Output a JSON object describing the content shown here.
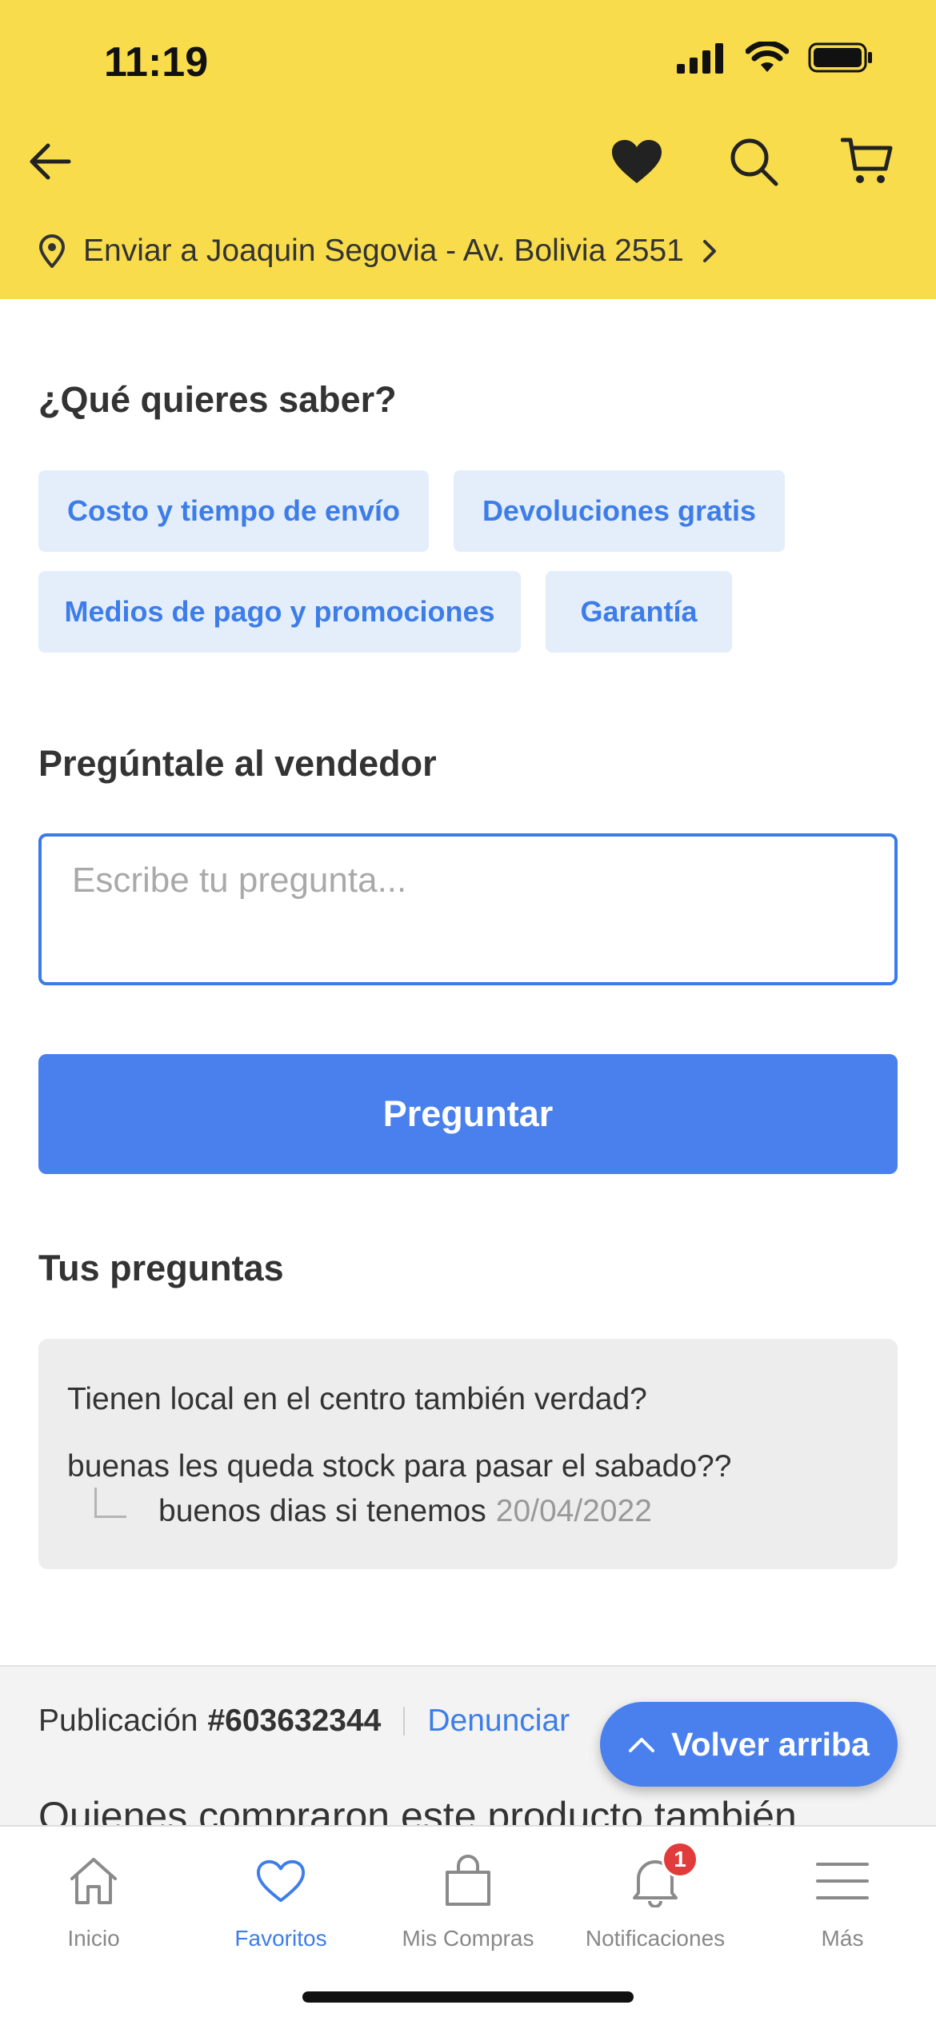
{
  "status_bar": {
    "time": "11:19"
  },
  "header": {
    "ship_to": "Enviar a Joaquin Segovia - Av. Bolivia 2551"
  },
  "faq": {
    "title": "¿Qué quieres saber?",
    "chips": [
      "Costo y tiempo de envío",
      "Devoluciones gratis",
      "Medios de pago y promociones",
      "Garantía"
    ]
  },
  "ask": {
    "title": "Pregúntale al vendedor",
    "placeholder": "Escribe tu pregunta...",
    "button_label": "Preguntar"
  },
  "your_questions": {
    "title": "Tus preguntas",
    "items": [
      {
        "question": "Tienen local en el centro también verdad?"
      },
      {
        "question": "buenas les queda stock para pasar el sabado??",
        "answer": "buenos dias si tenemos",
        "answer_date": "20/04/2022"
      }
    ]
  },
  "publication": {
    "label": "Publicación",
    "number": "#603632344",
    "report_label": "Denunciar"
  },
  "also_bought_title": "Quienes compraron este producto también",
  "back_to_top_label": "Volver arriba",
  "tabbar": {
    "items": [
      {
        "label": "Inicio",
        "icon": "home-icon"
      },
      {
        "label": "Favoritos",
        "icon": "heart-icon",
        "active": true
      },
      {
        "label": "Mis Compras",
        "icon": "bag-icon"
      },
      {
        "label": "Notificaciones",
        "icon": "bell-icon",
        "badge": "1"
      },
      {
        "label": "Más",
        "icon": "menu-icon"
      }
    ]
  },
  "colors": {
    "header_yellow": "#f8dc4b",
    "accent_blue": "#4a80ed",
    "chip_bg": "#e4eefb",
    "badge_red": "#e23b3b"
  }
}
